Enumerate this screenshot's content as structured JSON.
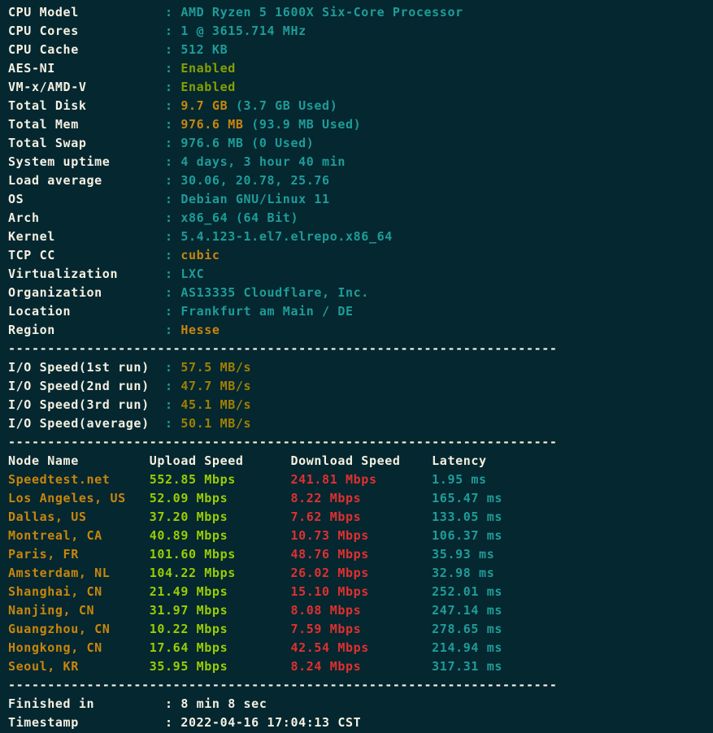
{
  "terminal": {
    "background_color": "#042730",
    "label_color": "#F5F0E1",
    "value_color": "#1F9C98",
    "enabled_color": "#88A000",
    "amber_color": "#C8860B",
    "io_color": "#A08000",
    "upload_color": "#9ACD00",
    "download_color": "#E03030",
    "latency_color": "#1F9C98",
    "separator": ":",
    "divider": "----------------------------------------------------------------------"
  },
  "system_info": {
    "rows": [
      {
        "label": "CPU Model",
        "value": "AMD Ryzen 5 1600X Six-Core Processor"
      },
      {
        "label": "CPU Cores",
        "value": "1 @ 3615.714 MHz"
      },
      {
        "label": "CPU Cache",
        "value": "512 KB"
      },
      {
        "label": "AES-NI",
        "value": "Enabled"
      },
      {
        "label": "VM-x/AMD-V",
        "value": "Enabled"
      },
      {
        "label": "Total Disk",
        "value_hl": "9.7 GB",
        "value_rest": " (3.7 GB Used)"
      },
      {
        "label": "Total Mem",
        "value_hl": "976.6 MB",
        "value_rest": " (93.9 MB Used)"
      },
      {
        "label": "Total Swap",
        "value": "976.6 MB (0 Used)"
      },
      {
        "label": "System uptime",
        "value": "4 days, 3 hour 40 min"
      },
      {
        "label": "Load average",
        "value": "30.06, 20.78, 25.76"
      },
      {
        "label": "OS",
        "value": "Debian GNU/Linux 11"
      },
      {
        "label": "Arch",
        "value": "x86_64 (64 Bit)"
      },
      {
        "label": "Kernel",
        "value": "5.4.123-1.el7.elrepo.x86_64"
      },
      {
        "label": "TCP CC",
        "value": "cubic"
      },
      {
        "label": "Virtualization",
        "value": "LXC"
      },
      {
        "label": "Organization",
        "value": "AS13335 Cloudflare, Inc."
      },
      {
        "label": "Location",
        "value": "Frankfurt am Main / DE"
      },
      {
        "label": "Region",
        "value": "Hesse"
      }
    ]
  },
  "io_speed": {
    "rows": [
      {
        "label": "I/O Speed(1st run)",
        "value": "57.5 MB/s"
      },
      {
        "label": "I/O Speed(2nd run)",
        "value": "47.7 MB/s"
      },
      {
        "label": "I/O Speed(3rd run)",
        "value": "45.1 MB/s"
      },
      {
        "label": "I/O Speed(average)",
        "value": "50.1 MB/s"
      }
    ]
  },
  "speedtest": {
    "headers": {
      "node": "Node Name",
      "upload": "Upload Speed",
      "download": "Download Speed",
      "latency": "Latency"
    },
    "rows": [
      {
        "node": "Speedtest.net",
        "upload": "552.85 Mbps",
        "download": "241.81 Mbps",
        "latency": "1.95 ms"
      },
      {
        "node": "Los Angeles, US",
        "upload": "52.09 Mbps",
        "download": "8.22 Mbps",
        "latency": "165.47 ms"
      },
      {
        "node": "Dallas, US",
        "upload": "37.20 Mbps",
        "download": "7.62 Mbps",
        "latency": "133.05 ms"
      },
      {
        "node": "Montreal, CA",
        "upload": "40.89 Mbps",
        "download": "10.73 Mbps",
        "latency": "106.37 ms"
      },
      {
        "node": "Paris, FR",
        "upload": "101.60 Mbps",
        "download": "48.76 Mbps",
        "latency": "35.93 ms"
      },
      {
        "node": "Amsterdam, NL",
        "upload": "104.22 Mbps",
        "download": "26.02 Mbps",
        "latency": "32.98 ms"
      },
      {
        "node": "Shanghai, CN",
        "upload": "21.49 Mbps",
        "download": "15.10 Mbps",
        "latency": "252.01 ms"
      },
      {
        "node": "Nanjing, CN",
        "upload": "31.97 Mbps",
        "download": "8.08 Mbps",
        "latency": "247.14 ms"
      },
      {
        "node": "Guangzhou, CN",
        "upload": "10.22 Mbps",
        "download": "7.59 Mbps",
        "latency": "278.65 ms"
      },
      {
        "node": "Hongkong, CN",
        "upload": "17.64 Mbps",
        "download": "42.54 Mbps",
        "latency": "214.94 ms"
      },
      {
        "node": "Seoul, KR",
        "upload": "35.95 Mbps",
        "download": "8.24 Mbps",
        "latency": "317.31 ms"
      }
    ]
  },
  "footer": {
    "rows": [
      {
        "label": "Finished in",
        "value": "8 min 8 sec"
      },
      {
        "label": "Timestamp",
        "value": "2022-04-16 17:04:13 CST"
      }
    ]
  }
}
